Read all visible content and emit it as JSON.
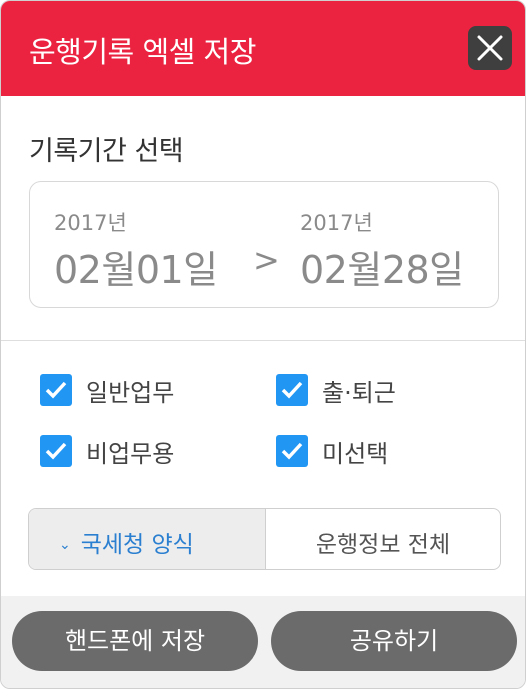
{
  "header": {
    "title": "운행기록 엑셀 저장",
    "close_icon": "close-icon"
  },
  "period": {
    "title": "기록기간 선택",
    "start": {
      "year": "2017년",
      "day": "02월01일"
    },
    "separator": ">",
    "end": {
      "year": "2017년",
      "day": "02월28일"
    }
  },
  "options": [
    {
      "label": "일반업무",
      "checked": true
    },
    {
      "label": "출·퇴근",
      "checked": true
    },
    {
      "label": "비업무용",
      "checked": true
    },
    {
      "label": "미선택",
      "checked": true
    }
  ],
  "format_tabs": {
    "left": {
      "label": "국세청 양식",
      "selected": true
    },
    "right": {
      "label": "운행정보 전체",
      "selected": false
    }
  },
  "footer": {
    "save_label": "핸드폰에 저장",
    "share_label": "공유하기"
  },
  "colors": {
    "accent": "#eb2340",
    "checkbox": "#2196f3",
    "link": "#2b7fd0",
    "button": "#6b6b6b"
  }
}
